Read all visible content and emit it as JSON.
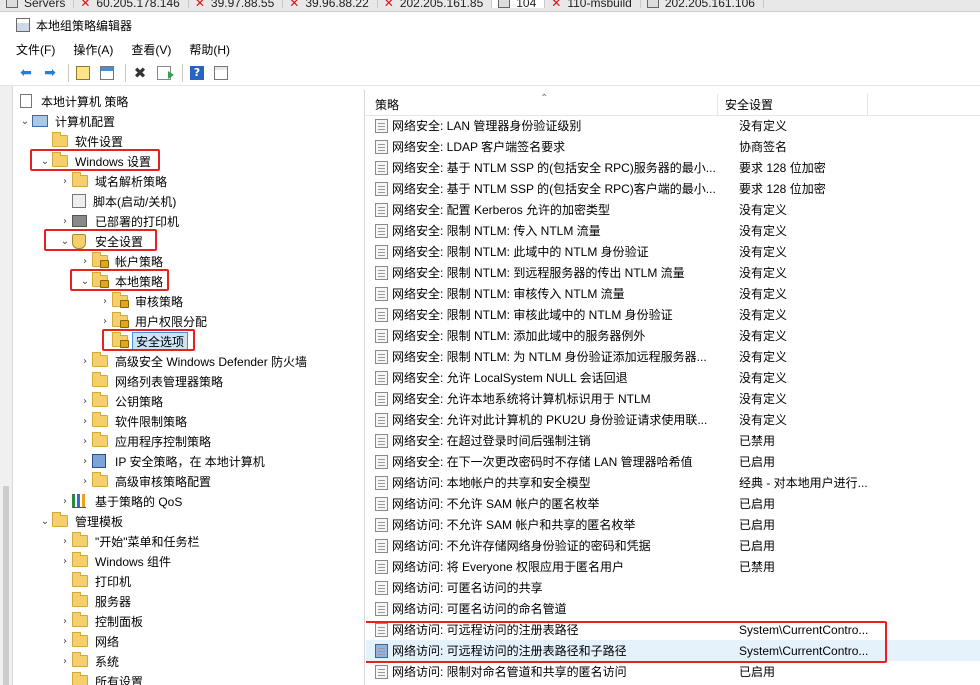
{
  "rdp_tabs": [
    {
      "label": "Servers",
      "kind": "server"
    },
    {
      "label": "60.205.178.146",
      "kind": "remote"
    },
    {
      "label": "39.97.88.55",
      "kind": "remote"
    },
    {
      "label": "39.96.88.22",
      "kind": "remote"
    },
    {
      "label": "202.205.161.85",
      "kind": "remote"
    },
    {
      "label": "104",
      "kind": "active"
    },
    {
      "label": "110-msbuild",
      "kind": "remote"
    },
    {
      "label": "202.205.161.106",
      "kind": "server"
    }
  ],
  "window": {
    "title": "本地组策略编辑器"
  },
  "menu": {
    "file": "文件(F)",
    "action": "操作(A)",
    "view": "查看(V)",
    "help": "帮助(H)"
  },
  "toolbar": {
    "icons": [
      "back-icon",
      "forward-icon",
      "up-folder-icon",
      "show-hide-tree-icon",
      "delete-icon",
      "export-icon",
      "help-icon",
      "properties-icon"
    ]
  },
  "tree": {
    "root": "本地计算机 策略",
    "computer_config": "计算机配置",
    "software_settings": "软件设置",
    "windows_settings": "Windows 设置",
    "dns_policy": "域名解析策略",
    "scripts": "脚本(启动/关机)",
    "printers": "已部署的打印机",
    "security_settings": "安全设置",
    "account_policy": "帐户策略",
    "local_policy": "本地策略",
    "audit_policy": "审核策略",
    "user_rights": "用户权限分配",
    "security_options": "安全选项",
    "defender_firewall": "高级安全 Windows Defender 防火墙",
    "network_list": "网络列表管理器策略",
    "public_key": "公钥策略",
    "software_restriction": "软件限制策略",
    "app_control": "应用程序控制策略",
    "ip_security": "IP 安全策略，在 本地计算机",
    "advanced_audit": "高级审核策略配置",
    "qos": "基于策略的 QoS",
    "admin_templates": "管理模板",
    "start_menu": "\"开始\"菜单和任务栏",
    "windows_components": "Windows 组件",
    "printers2": "打印机",
    "servers": "服务器",
    "control_panel": "控制面板",
    "network": "网络",
    "system": "系统",
    "all_settings": "所有设置"
  },
  "list": {
    "col_policy": "策略",
    "col_setting": "安全设置",
    "rows": [
      {
        "policy": "网络安全: LAN 管理器身份验证级别",
        "setting": "没有定义"
      },
      {
        "policy": "网络安全: LDAP 客户端签名要求",
        "setting": "协商签名"
      },
      {
        "policy": "网络安全: 基于 NTLM SSP 的(包括安全 RPC)服务器的最小...",
        "setting": "要求 128 位加密"
      },
      {
        "policy": "网络安全: 基于 NTLM SSP 的(包括安全 RPC)客户端的最小...",
        "setting": "要求 128 位加密"
      },
      {
        "policy": "网络安全: 配置 Kerberos 允许的加密类型",
        "setting": "没有定义"
      },
      {
        "policy": "网络安全: 限制 NTLM: 传入 NTLM 流量",
        "setting": "没有定义"
      },
      {
        "policy": "网络安全: 限制 NTLM: 此域中的 NTLM 身份验证",
        "setting": "没有定义"
      },
      {
        "policy": "网络安全: 限制 NTLM: 到远程服务器的传出 NTLM 流量",
        "setting": "没有定义"
      },
      {
        "policy": "网络安全: 限制 NTLM: 审核传入 NTLM 流量",
        "setting": "没有定义"
      },
      {
        "policy": "网络安全: 限制 NTLM: 审核此域中的 NTLM 身份验证",
        "setting": "没有定义"
      },
      {
        "policy": "网络安全: 限制 NTLM: 添加此域中的服务器例外",
        "setting": "没有定义"
      },
      {
        "policy": "网络安全: 限制 NTLM: 为 NTLM 身份验证添加远程服务器...",
        "setting": "没有定义"
      },
      {
        "policy": "网络安全: 允许 LocalSystem NULL 会话回退",
        "setting": "没有定义"
      },
      {
        "policy": "网络安全: 允许本地系统将计算机标识用于 NTLM",
        "setting": "没有定义"
      },
      {
        "policy": "网络安全: 允许对此计算机的 PKU2U 身份验证请求使用联...",
        "setting": "没有定义"
      },
      {
        "policy": "网络安全: 在超过登录时间后强制注销",
        "setting": "已禁用"
      },
      {
        "policy": "网络安全: 在下一次更改密码时不存储 LAN 管理器哈希值",
        "setting": "已启用"
      },
      {
        "policy": "网络访问: 本地帐户的共享和安全模型",
        "setting": "经典 - 对本地用户进行..."
      },
      {
        "policy": "网络访问: 不允许 SAM 帐户的匿名枚举",
        "setting": "已启用"
      },
      {
        "policy": "网络访问: 不允许 SAM 帐户和共享的匿名枚举",
        "setting": "已启用"
      },
      {
        "policy": "网络访问: 不允许存储网络身份验证的密码和凭据",
        "setting": "已启用"
      },
      {
        "policy": "网络访问: 将 Everyone 权限应用于匿名用户",
        "setting": "已禁用"
      },
      {
        "policy": "网络访问: 可匿名访问的共享",
        "setting": ""
      },
      {
        "policy": "网络访问: 可匿名访问的命名管道",
        "setting": ""
      },
      {
        "policy": "网络访问: 可远程访问的注册表路径",
        "setting": "System\\CurrentContro..."
      },
      {
        "policy": "网络访问: 可远程访问的注册表路径和子路径",
        "setting": "System\\CurrentContro..."
      },
      {
        "policy": "网络访问: 限制对命名管道和共享的匿名访问",
        "setting": "已启用"
      }
    ]
  }
}
